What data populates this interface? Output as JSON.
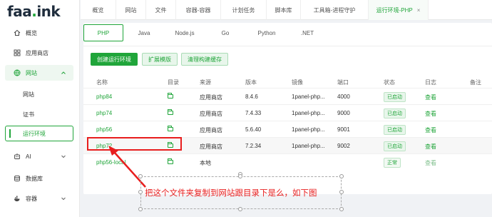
{
  "logo": {
    "text": "faa",
    "dot": ".",
    "suffix": "ink"
  },
  "sidebar": {
    "items": [
      {
        "label": "概览"
      },
      {
        "label": "应用商店"
      },
      {
        "label": "网站"
      },
      {
        "label": "网站"
      },
      {
        "label": "证书"
      },
      {
        "label": "运行环境"
      },
      {
        "label": "AI"
      },
      {
        "label": "数据库"
      },
      {
        "label": "容器"
      }
    ]
  },
  "top_tabs": [
    "概览",
    "网站",
    "文件",
    "容器-容器",
    "计划任务",
    "脚本库",
    "工具箱-进程守护",
    "运行环境-PHP"
  ],
  "top_tab_close": "×",
  "lang_tabs": [
    "PHP",
    "Java",
    "Node.js",
    "Go",
    "Python",
    ".NET"
  ],
  "buttons": {
    "create": "创建运行环境",
    "extend": "扩展模版",
    "clear": "清理构建缓存"
  },
  "table": {
    "headers": [
      "名称",
      "目录",
      "来源",
      "版本",
      "镜像",
      "端口",
      "状态",
      "日志",
      "备注"
    ],
    "rows": [
      {
        "name": "php84",
        "source": "应用商店",
        "version": "8.4.6",
        "image": "1panel-php...",
        "port": "4000",
        "status": "已启动",
        "log": "查看"
      },
      {
        "name": "php74",
        "source": "应用商店",
        "version": "7.4.33",
        "image": "1panel-php...",
        "port": "9000",
        "status": "已启动",
        "log": "查看"
      },
      {
        "name": "php56",
        "source": "应用商店",
        "version": "5.6.40",
        "image": "1panel-php...",
        "port": "9001",
        "status": "已启动",
        "log": "查看"
      },
      {
        "name": "php72",
        "source": "应用商店",
        "version": "7.2.34",
        "image": "1panel-php...",
        "port": "9002",
        "status": "已启动",
        "log": "查看"
      },
      {
        "name": "php56-local",
        "source": "本地",
        "version": "",
        "image": "",
        "port": "",
        "status": "正常",
        "log": "查看"
      }
    ]
  },
  "annotation": "把这个文件夹复制到网站跟目录下是么，如下图",
  "colors": {
    "accent": "#20a53a",
    "annotation": "#e81e1e"
  }
}
